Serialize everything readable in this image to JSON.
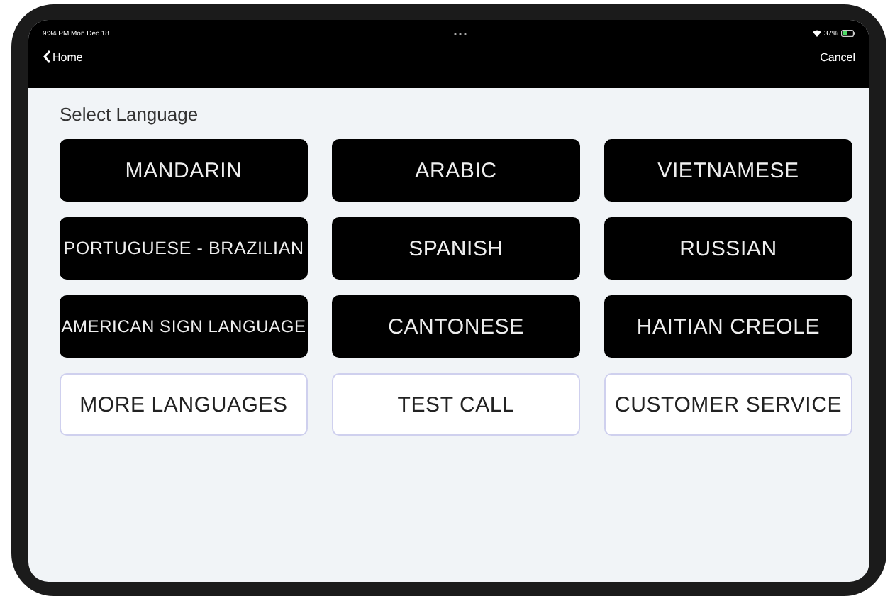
{
  "status_bar": {
    "time": "9:34 PM  Mon Dec 18",
    "battery_text": "37%"
  },
  "nav_bar": {
    "back_label": "Home",
    "action": "Cancel"
  },
  "heading": "Select Language",
  "buttons": [
    {
      "label": "MANDARIN",
      "kind": "dark"
    },
    {
      "label": "ARABIC",
      "kind": "dark"
    },
    {
      "label": "VIETNAMESE",
      "kind": "dark"
    },
    {
      "label": "PORTUGUESE - BRAZILIAN",
      "kind": "dark"
    },
    {
      "label": "SPANISH",
      "kind": "dark"
    },
    {
      "label": "RUSSIAN",
      "kind": "dark"
    },
    {
      "label": "AMERICAN SIGN LANGUAGE",
      "kind": "dark"
    },
    {
      "label": "CANTONESE",
      "kind": "dark"
    },
    {
      "label": "HAITIAN CREOLE",
      "kind": "dark"
    },
    {
      "label": "MORE LANGUAGES",
      "kind": "light"
    },
    {
      "label": "TEST CALL",
      "kind": "light"
    },
    {
      "label": "CUSTOMER SERVICE",
      "kind": "light"
    }
  ]
}
